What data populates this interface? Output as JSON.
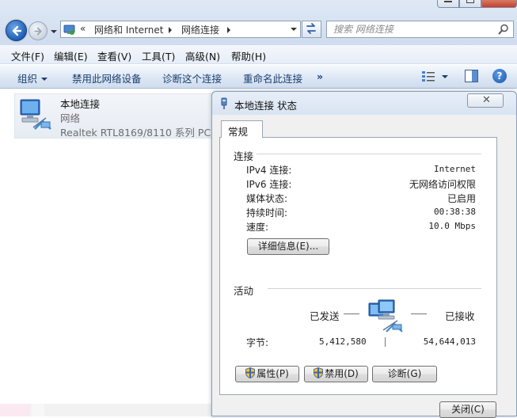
{
  "address_bar": {
    "breadcrumb": [
      "网络和 Internet",
      "网络连接"
    ],
    "overflow_marker": "«"
  },
  "search": {
    "placeholder": "搜索 网络连接"
  },
  "menu": {
    "items": [
      "文件(F)",
      "编辑(E)",
      "查看(V)",
      "工具(T)",
      "高级(N)",
      "帮助(H)"
    ]
  },
  "command_bar": {
    "organize": "组织",
    "disable": "禁用此网络设备",
    "diagnose": "诊断这个连接",
    "rename": "重命名此连接",
    "more": "»",
    "help": "?"
  },
  "connection": {
    "name": "本地连接",
    "type": "网络",
    "device": "Realtek RTL8169/8110 系列 PC..."
  },
  "dialog": {
    "title": "本地连接 状态",
    "close_glyph": "✕",
    "tab": "常规",
    "connection_group": "连接",
    "rows": [
      {
        "label": "IPv4 连接:",
        "value": "Internet"
      },
      {
        "label": "IPv6 连接:",
        "value": "无网络访问权限"
      },
      {
        "label": "媒体状态:",
        "value": "已启用"
      },
      {
        "label": "持续时间:",
        "value": "00:38:38"
      },
      {
        "label": "速度:",
        "value": "10.0 Mbps"
      }
    ],
    "details_button": "详细信息(E)...",
    "activity_group": "活动",
    "sent_label": "已发送",
    "received_label": "已接收",
    "bytes_label": "字节:",
    "bytes_sent": "5,412,580",
    "bytes_received": "54,644,013",
    "properties_button": "属性(P)",
    "disable_button": "禁用(D)",
    "diagnose_button": "诊断(G)",
    "close_button": "关闭(C)"
  },
  "icons": {
    "back": "back-arrow-icon",
    "forward": "forward-arrow-icon",
    "refresh": "refresh-icon",
    "search": "search-icon",
    "network": "network-computer-icon",
    "shield": "uac-shield-icon"
  },
  "colors": {
    "command_text": "#1a3d6d",
    "back_button": "#1d5fb4",
    "help_icon": "#1e55a8"
  }
}
